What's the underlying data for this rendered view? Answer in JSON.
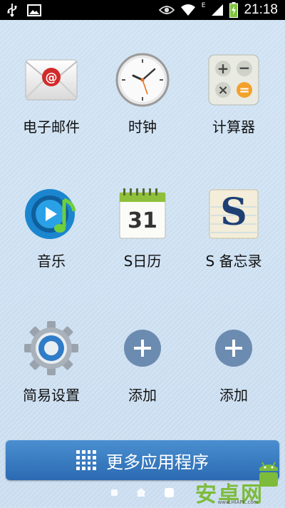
{
  "status_bar": {
    "time": "21:18",
    "network_type": "E",
    "icons": [
      "usb-icon",
      "image-icon",
      "eye-icon",
      "wifi-icon",
      "signal-icon",
      "battery-icon"
    ]
  },
  "apps": [
    {
      "label": "电子邮件",
      "icon": "email-icon"
    },
    {
      "label": "时钟",
      "icon": "clock-icon"
    },
    {
      "label": "计算器",
      "icon": "calculator-icon"
    },
    {
      "label": "音乐",
      "icon": "music-icon"
    },
    {
      "label": "S日历",
      "icon": "calendar-icon",
      "calendar_day": "31"
    },
    {
      "label": "S 备忘录",
      "icon": "memo-icon",
      "memo_letter": "S"
    },
    {
      "label": "简易设置",
      "icon": "settings-gear-icon"
    },
    {
      "label": "添加",
      "icon": "add-icon"
    },
    {
      "label": "添加",
      "icon": "add-icon"
    }
  ],
  "more_apps_button": {
    "label": "更多应用程序",
    "icon": "grid-icon"
  },
  "pager": {
    "pages": 3,
    "current": 3
  },
  "watermark": {
    "text": "安卓网",
    "url_text": "www.HIAPK.com"
  },
  "colors": {
    "background": "#cfe2f3",
    "button": "#3479bf",
    "add_button": "#6c8bb0"
  }
}
